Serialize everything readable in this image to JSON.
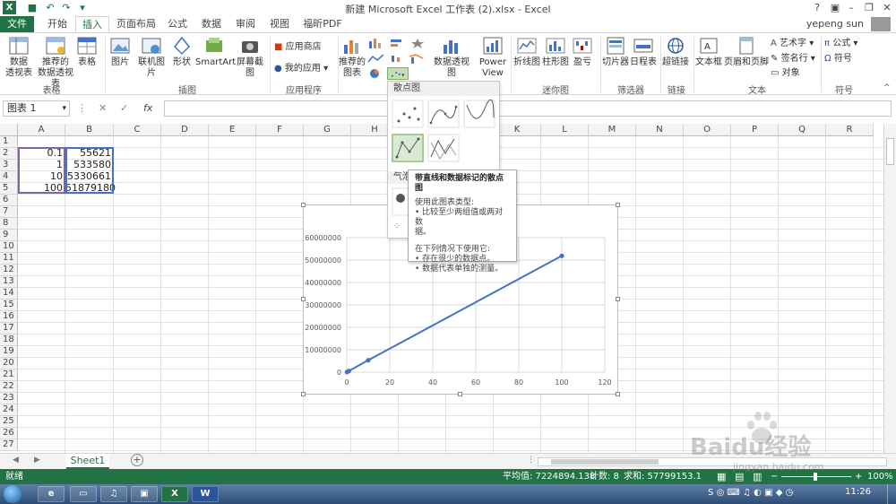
{
  "window": {
    "title": "新建 Microsoft Excel 工作表 (2).xlsx - Excel",
    "user": "yepeng sun",
    "help": "?"
  },
  "tabs": [
    "文件",
    "开始",
    "插入",
    "页面布局",
    "公式",
    "数据",
    "审阅",
    "视图",
    "福昕PDF"
  ],
  "ribbon": {
    "groups": {
      "tables": "表格",
      "illustrations": "插图",
      "apps": "应用程序",
      "sparklines": "迷你图",
      "filters": "筛选器",
      "links": "链接",
      "text": "文本",
      "symbols": "符号"
    },
    "buttons": {
      "pivot_table": "数据\n透视表",
      "recommended_pivot": "推荐的\n数据透视表",
      "table": "表格",
      "picture": "图片",
      "online_picture": "联机图片",
      "shapes": "形状",
      "smartart": "SmartArt",
      "screenshot": "屏幕截图",
      "app_store": "应用商店",
      "my_apps": "我的应用",
      "recommended_charts": "推荐的\n图表",
      "pivot_chart": "数据透视图",
      "power_view": "Power\nView",
      "line": "折线图",
      "column": "柱形图",
      "win_loss": "盈亏",
      "slicer": "切片器",
      "timeline": "日程表",
      "hyperlink": "超链接",
      "textbox": "文本框",
      "header_footer": "页眉和页脚",
      "wordart": "艺术字",
      "signature": "签名行",
      "object": "对象",
      "equation": "公式",
      "symbol": "符号"
    }
  },
  "formula_bar": {
    "name_box": "图表 1",
    "cancel": "✕",
    "enter": "✓",
    "fx": "fx",
    "value": ""
  },
  "grid": {
    "columns": [
      "A",
      "B",
      "C",
      "D",
      "E",
      "F",
      "G",
      "H",
      "I",
      "J",
      "K",
      "L",
      "M",
      "N",
      "O",
      "P",
      "Q",
      "R"
    ],
    "rows": [
      "1",
      "2",
      "3",
      "4",
      "5",
      "6",
      "7",
      "8",
      "9",
      "10",
      "11",
      "12",
      "13",
      "14",
      "15",
      "16",
      "17",
      "18",
      "19",
      "20",
      "21",
      "22",
      "23",
      "24",
      "25",
      "26",
      "27"
    ],
    "cells": {
      "A2": "0.1",
      "B2": "55621",
      "A3": "1",
      "B3": "533580",
      "A4": "10",
      "B4": "5330661",
      "A5": "100",
      "B5": "51879180"
    }
  },
  "gallery": {
    "title": "散点图",
    "bubble_label": "气泡"
  },
  "tooltip": {
    "title": "带直线和数据标记的散点图",
    "line1": "使用此图表类型:",
    "line2": "• 比较至少两组值或两对数",
    "line3": "据。",
    "line4": "在下列情况下使用它:",
    "line5": "• 存在很少的数据点。",
    "line6": "• 数据代表单独的测量。"
  },
  "chart_data": {
    "type": "scatter",
    "x": [
      0.1,
      1,
      10,
      100
    ],
    "series": [
      {
        "values": [
          55621,
          533580,
          5330661,
          51879180
        ]
      }
    ],
    "xlim": [
      0,
      120
    ],
    "ylim": [
      0,
      60000000
    ],
    "x_ticks": [
      "0",
      "20",
      "40",
      "60",
      "80",
      "100",
      "120"
    ],
    "y_ticks": [
      "0",
      "10000000",
      "20000000",
      "30000000",
      "40000000",
      "50000000",
      "60000000"
    ],
    "grid": true,
    "line_color": "#4472c4",
    "title": "",
    "xlabel": "",
    "ylabel": ""
  },
  "sheets": [
    "Sheet1"
  ],
  "status": {
    "mode": "就绪",
    "average": "平均值: 7224894.138",
    "count": "计数: 8",
    "sum": "求和: 57799153.1",
    "zoom": "100%"
  },
  "taskbar": {
    "clock": "11:26"
  },
  "watermark": {
    "text1": "Baidu经验",
    "text2": "jingyan.baidu.com"
  },
  "colors": {
    "excel_green": "#217346",
    "selection": "#217346"
  }
}
